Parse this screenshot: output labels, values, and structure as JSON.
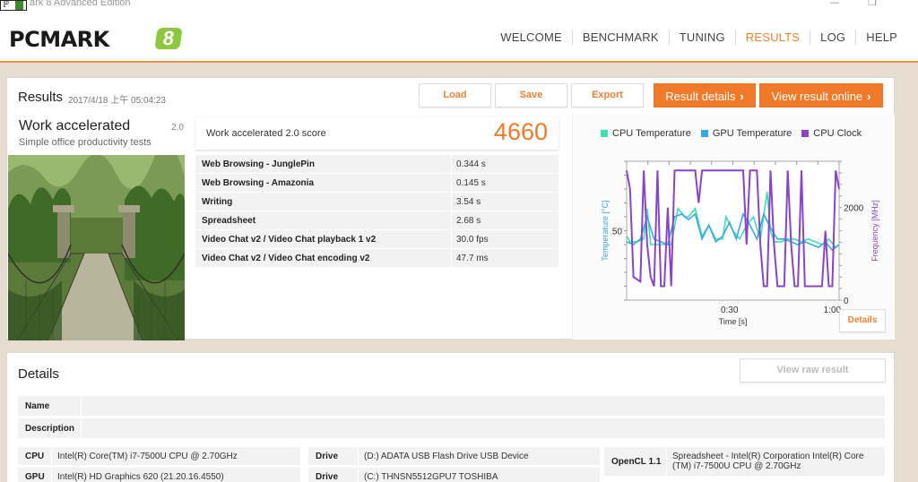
{
  "window": {
    "title": "ark 8 Advanced Edition"
  },
  "header": {
    "logo_text": "PCMARK",
    "logo_badge": "8",
    "nav": [
      {
        "label": "WELCOME",
        "active": false
      },
      {
        "label": "BENCHMARK",
        "active": false
      },
      {
        "label": "TUNING",
        "active": false
      },
      {
        "label": "RESULTS",
        "active": true
      },
      {
        "label": "LOG",
        "active": false
      },
      {
        "label": "HELP",
        "active": false
      }
    ]
  },
  "results": {
    "title": "Results",
    "date": "2017/4/18 上午 05:04:23",
    "buttons": {
      "load": "Load",
      "save": "Save",
      "export": "Export",
      "result_details": "Result details",
      "view_online": "View result online"
    },
    "test": {
      "name": "Work accelerated",
      "version": "2.0",
      "description": "Simple office productivity tests"
    },
    "score": {
      "label": "Work accelerated 2.0 score",
      "value": "4660"
    },
    "subscores": [
      {
        "name": "Web Browsing - JunglePin",
        "value": "0.344 s"
      },
      {
        "name": "Web Browsing - Amazonia",
        "value": "0.145 s"
      },
      {
        "name": "Writing",
        "value": "3.54 s"
      },
      {
        "name": "Spreadsheet",
        "value": "2.68 s"
      },
      {
        "name": "Video Chat v2 / Video Chat playback 1 v2",
        "value": "30.0 fps"
      },
      {
        "name": "Video Chat v2 / Video Chat encoding v2",
        "value": "47.7 ms"
      }
    ],
    "details_button": "Details"
  },
  "chart_data": {
    "type": "line",
    "legend": [
      {
        "name": "CPU Temperature",
        "color": "#3ee0b0"
      },
      {
        "name": "GPU Temperature",
        "color": "#38a8e8"
      },
      {
        "name": "CPU Clock",
        "color": "#8a44c8"
      }
    ],
    "xlabel": "Time [s]",
    "ylabel_left": "Temperature [°C]",
    "ylabel_right": "Frequency [MHz]",
    "x_ticks": [
      "0:30",
      "1:00"
    ],
    "y_left_ticks": [
      "50"
    ],
    "y_right_ticks": [
      "2000",
      "0"
    ],
    "xlim": [
      0,
      62
    ],
    "ylim_left": [
      25,
      75
    ],
    "ylim_right": [
      0,
      3000
    ],
    "series": [
      {
        "name": "CPU Temperature",
        "x": [
          0,
          1,
          3,
          5,
          6,
          7,
          9,
          11,
          13,
          15,
          17,
          18,
          20,
          22,
          24,
          26,
          28,
          29,
          31,
          33,
          35,
          37,
          39,
          41,
          42,
          43,
          45,
          47,
          49,
          51,
          53,
          55,
          57,
          59,
          61,
          62
        ],
        "y": [
          48,
          46,
          46,
          47,
          58,
          45,
          45,
          45,
          45,
          58,
          55,
          55,
          58,
          48,
          52,
          47,
          47,
          55,
          50,
          47,
          52,
          55,
          47,
          64,
          50,
          46,
          46,
          47,
          47,
          46,
          47,
          46,
          45,
          47,
          44,
          45
        ]
      },
      {
        "name": "GPU Temperature",
        "x": [
          0,
          2,
          4,
          6,
          8,
          10,
          12,
          14,
          16,
          18,
          20,
          22,
          24,
          26,
          28,
          30,
          32,
          34,
          36,
          38,
          40,
          42,
          44,
          46,
          48,
          50,
          52,
          54,
          56,
          58,
          60,
          62
        ],
        "y": [
          46,
          45,
          47,
          55,
          47,
          46,
          45,
          55,
          56,
          54,
          56,
          47,
          52,
          46,
          48,
          53,
          47,
          56,
          52,
          47,
          56,
          51,
          47,
          47,
          46,
          45,
          46,
          45,
          44,
          46,
          43,
          45
        ]
      },
      {
        "name": "CPU Clock",
        "x": [
          0,
          1,
          2,
          4,
          5,
          6,
          7,
          8,
          9,
          10,
          11,
          12,
          13,
          14,
          16,
          18,
          20,
          21,
          22,
          23,
          24,
          26,
          28,
          30,
          32,
          34,
          35,
          36,
          37,
          38,
          39,
          40,
          41,
          42,
          43,
          44,
          45,
          46,
          47,
          48,
          49,
          50,
          51,
          52,
          53,
          55,
          57,
          58,
          59,
          60,
          61,
          62
        ],
        "y": [
          2800,
          2400,
          500,
          400,
          2800,
          1200,
          500,
          300,
          2800,
          300,
          300,
          2000,
          300,
          2800,
          2800,
          2800,
          2800,
          2100,
          2800,
          2800,
          2800,
          2800,
          2800,
          2800,
          2800,
          2800,
          1200,
          2800,
          2800,
          2800,
          1200,
          300,
          300,
          2800,
          1200,
          300,
          300,
          300,
          2800,
          1200,
          300,
          300,
          2800,
          300,
          300,
          300,
          300,
          1500,
          300,
          300,
          2800,
          2400
        ]
      }
    ]
  },
  "details": {
    "title": "Details",
    "view_raw": "View raw result",
    "name_label": "Name",
    "description_label": "Description",
    "system": [
      {
        "key": "CPU",
        "value": "Intel(R) Core(TM) i7-7500U CPU @ 2.70GHz"
      },
      {
        "key": "GPU",
        "value": "Intel(R) HD Graphics 620 (21.20.16.4550)"
      }
    ],
    "drives": [
      {
        "key": "Drive",
        "value": "(D:) ADATA USB Flash Drive USB Device"
      },
      {
        "key": "Drive",
        "value": "(C:) THNSN5512GPU7 TOSHIBA"
      }
    ],
    "opencl": {
      "key": "OpenCL 1.1",
      "value": "Spreadsheet - Intel(R) Corporation Intel(R) Core (TM) i7-7500U CPU @ 2.70GHz"
    }
  }
}
